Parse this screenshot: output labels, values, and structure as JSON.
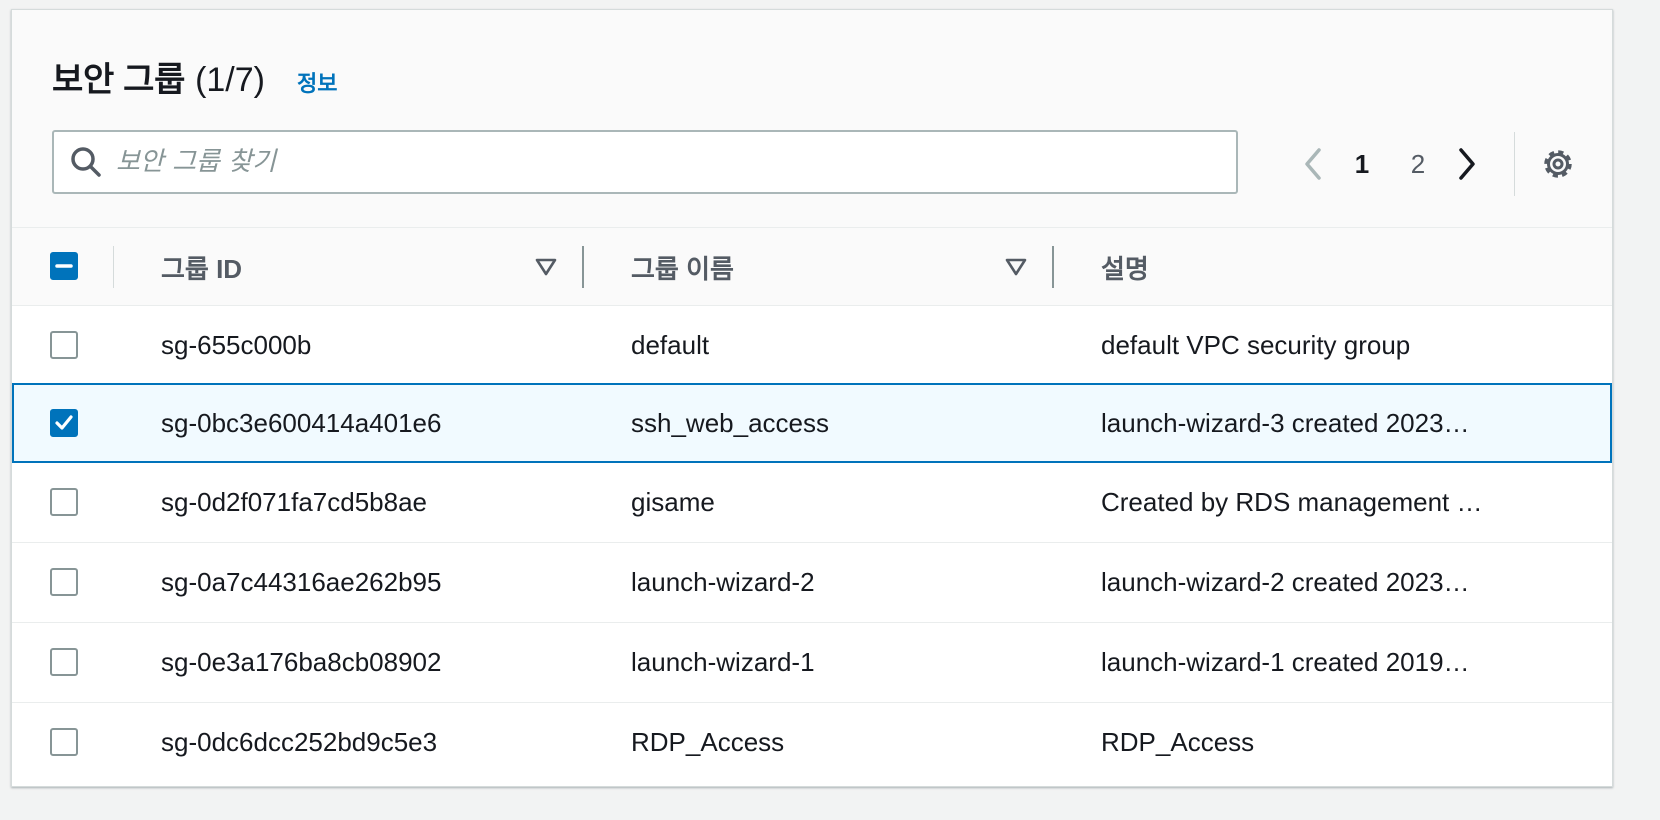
{
  "header": {
    "title": "보안 그룹",
    "count": "(1/7)",
    "info_link": "정보"
  },
  "search": {
    "placeholder": "보안 그룹 찾기",
    "value": ""
  },
  "pagination": {
    "pages": [
      "1",
      "2"
    ],
    "current": "1"
  },
  "table": {
    "columns": {
      "id": "그룹 ID",
      "name": "그룹 이름",
      "description": "설명"
    },
    "rows": [
      {
        "id": "sg-655c000b",
        "name": "default",
        "description": "default VPC security group",
        "selected": false
      },
      {
        "id": "sg-0bc3e600414a401e6",
        "name": "ssh_web_access",
        "description": "launch-wizard-3 created 2023…",
        "selected": true
      },
      {
        "id": "sg-0d2f071fa7cd5b8ae",
        "name": "gisame",
        "description": "Created by RDS management …",
        "selected": false
      },
      {
        "id": "sg-0a7c44316ae262b95",
        "name": "launch-wizard-2",
        "description": "launch-wizard-2 created 2023…",
        "selected": false
      },
      {
        "id": "sg-0e3a176ba8cb08902",
        "name": "launch-wizard-1",
        "description": "launch-wizard-1 created 2019…",
        "selected": false
      },
      {
        "id": "sg-0dc6dcc252bd9c5e3",
        "name": "RDP_Access",
        "description": "RDP_Access",
        "selected": false
      }
    ]
  },
  "colors": {
    "accent": "#0073bb",
    "selected_row_bg": "#f1faff",
    "text": "#16191f",
    "muted": "#545b64"
  },
  "icons": {
    "search": "search-icon",
    "prev": "chevron-left-icon",
    "next": "chevron-right-icon",
    "settings": "gear-icon",
    "sort": "sort-down-triangle-icon",
    "select_all": "indeterminate-checkbox",
    "row_checked": "check-icon"
  }
}
